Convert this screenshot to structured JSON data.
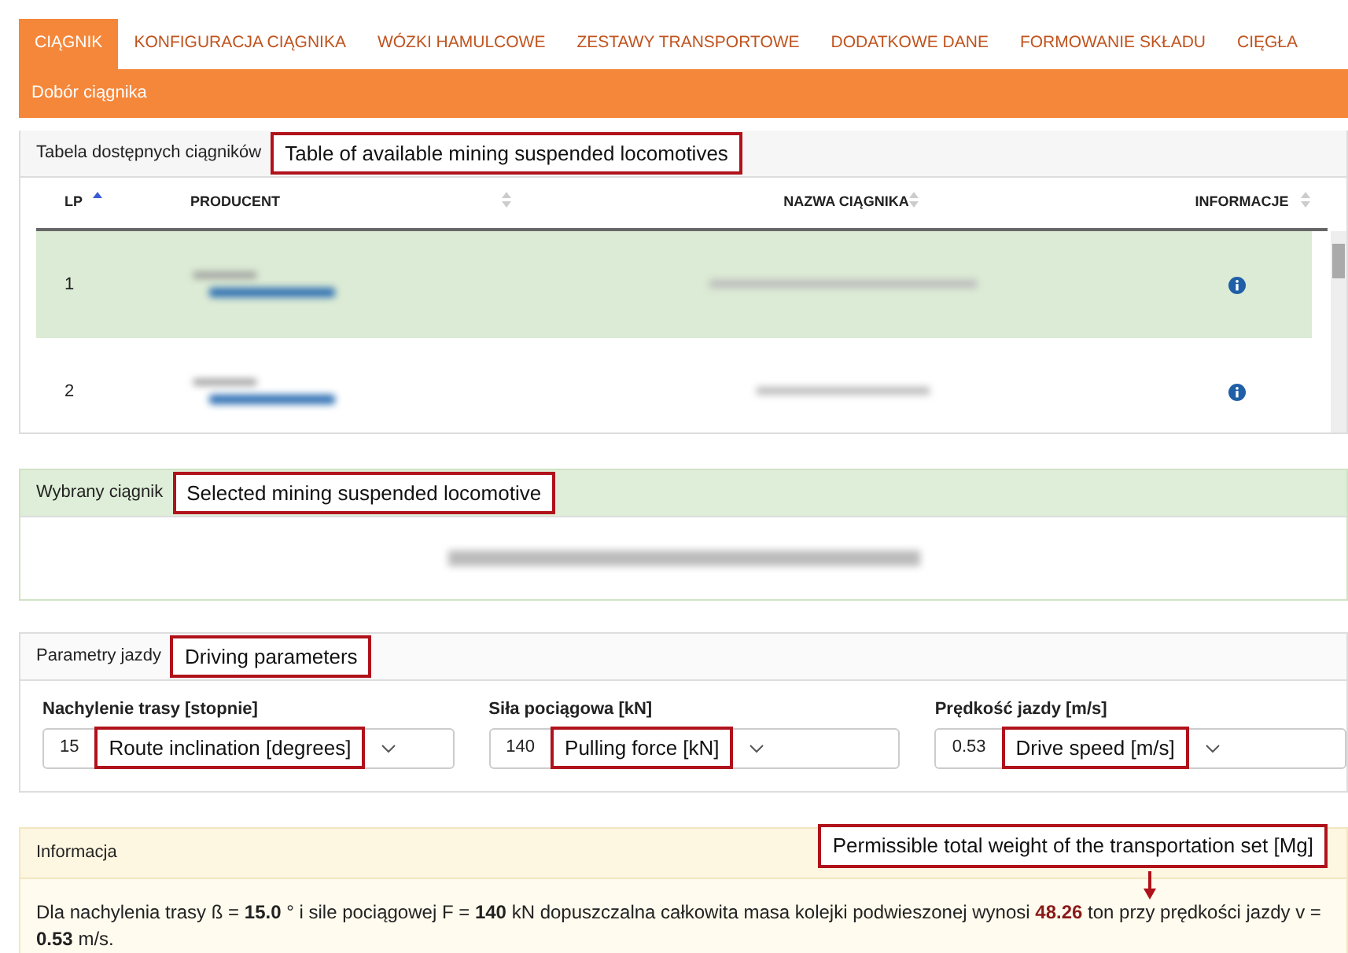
{
  "tabs": [
    {
      "label": "CIĄGNIK",
      "selected": true
    },
    {
      "label": "KONFIGURACJA CIĄGNIKA",
      "selected": false
    },
    {
      "label": "WÓZKI HAMULCOWE",
      "selected": false
    },
    {
      "label": "ZESTAWY TRANSPORTOWE",
      "selected": false
    },
    {
      "label": "DODATKOWE DANE",
      "selected": false
    },
    {
      "label": "FORMOWANIE SKŁADU",
      "selected": false
    },
    {
      "label": "CIĘGŁA",
      "selected": false
    }
  ],
  "section_title": "Dobór ciągnika",
  "table_panel": {
    "title": "Tabela dostępnych ciągników",
    "annotation": "Table of available mining suspended locomotives",
    "columns": [
      {
        "label": "LP",
        "sorted": true
      },
      {
        "label": "PRODUCENT",
        "sorted": false
      },
      {
        "label": "NAZWA CIĄGNIKA",
        "sorted": false
      },
      {
        "label": "INFORMACJE",
        "sorted": false
      }
    ],
    "rows": [
      {
        "lp": "1",
        "selected": true
      },
      {
        "lp": "2",
        "selected": false
      }
    ]
  },
  "selected_panel": {
    "title": "Wybrany ciągnik",
    "annotation": "Selected mining suspended locomotive"
  },
  "params_panel": {
    "title": "Parametry jazdy",
    "annotation": "Driving parameters",
    "fields": [
      {
        "label": "Nachylenie trasy [stopnie]",
        "value": "15",
        "annotation": "Route inclination [degrees]"
      },
      {
        "label": "Siła pociągowa [kN]",
        "value": "140",
        "annotation": "Pulling force [kN]"
      },
      {
        "label": "Prędkość jazdy [m/s]",
        "value": "0.53",
        "annotation": "Drive speed [m/s]"
      }
    ]
  },
  "info_panel": {
    "title": "Informacja",
    "annotation": "Permissible total weight of the transportation set [Mg]",
    "text": "Dla nachylenia trasy ß = **15.0** ° i sile pociągowej F = **140** kN dopuszczalna całkowita masa kolejki podwieszonej wynosi **48.26** ton przy prędkości jazdy v = **0.53** m/s."
  }
}
